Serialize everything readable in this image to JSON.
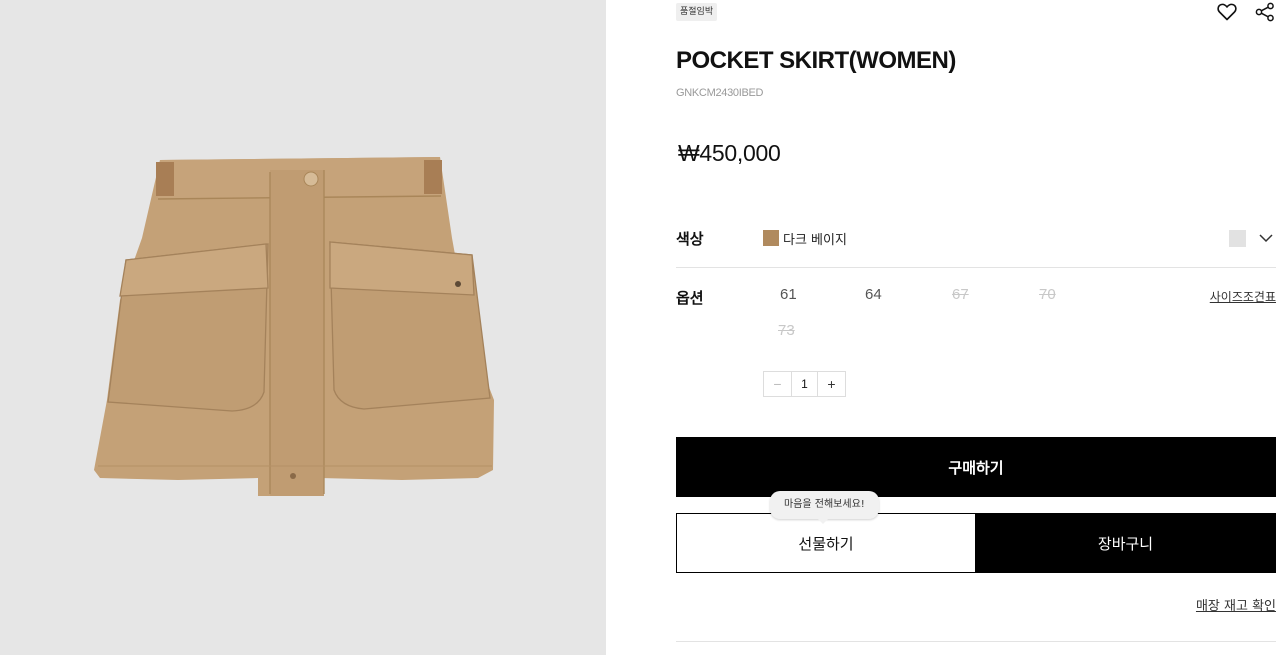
{
  "badge": "품절임박",
  "product": {
    "title": "POCKET SKIRT(WOMEN)",
    "code": "GNKCM2430IBED",
    "price": "₩450,000"
  },
  "color": {
    "label": "색상",
    "selected_name": "다크 베이지",
    "swatch_hex": "#b08a5e"
  },
  "option": {
    "label": "옵션",
    "sizes": [
      {
        "label": "61",
        "available": true
      },
      {
        "label": "64",
        "available": true
      },
      {
        "label": "67",
        "available": false
      },
      {
        "label": "70",
        "available": false
      },
      {
        "label": "73",
        "available": false
      }
    ],
    "size_guide": "사이즈조견표"
  },
  "quantity": {
    "minus": "−",
    "value": "1",
    "plus": "+"
  },
  "actions": {
    "buy": "구매하기",
    "gift": "선물하기",
    "gift_tooltip": "마음을 전해보세요!",
    "cart": "장바구니",
    "store_stock": "매장 재고 확인"
  },
  "icons": [
    "heart-icon",
    "share-icon",
    "chevron-down-icon"
  ]
}
